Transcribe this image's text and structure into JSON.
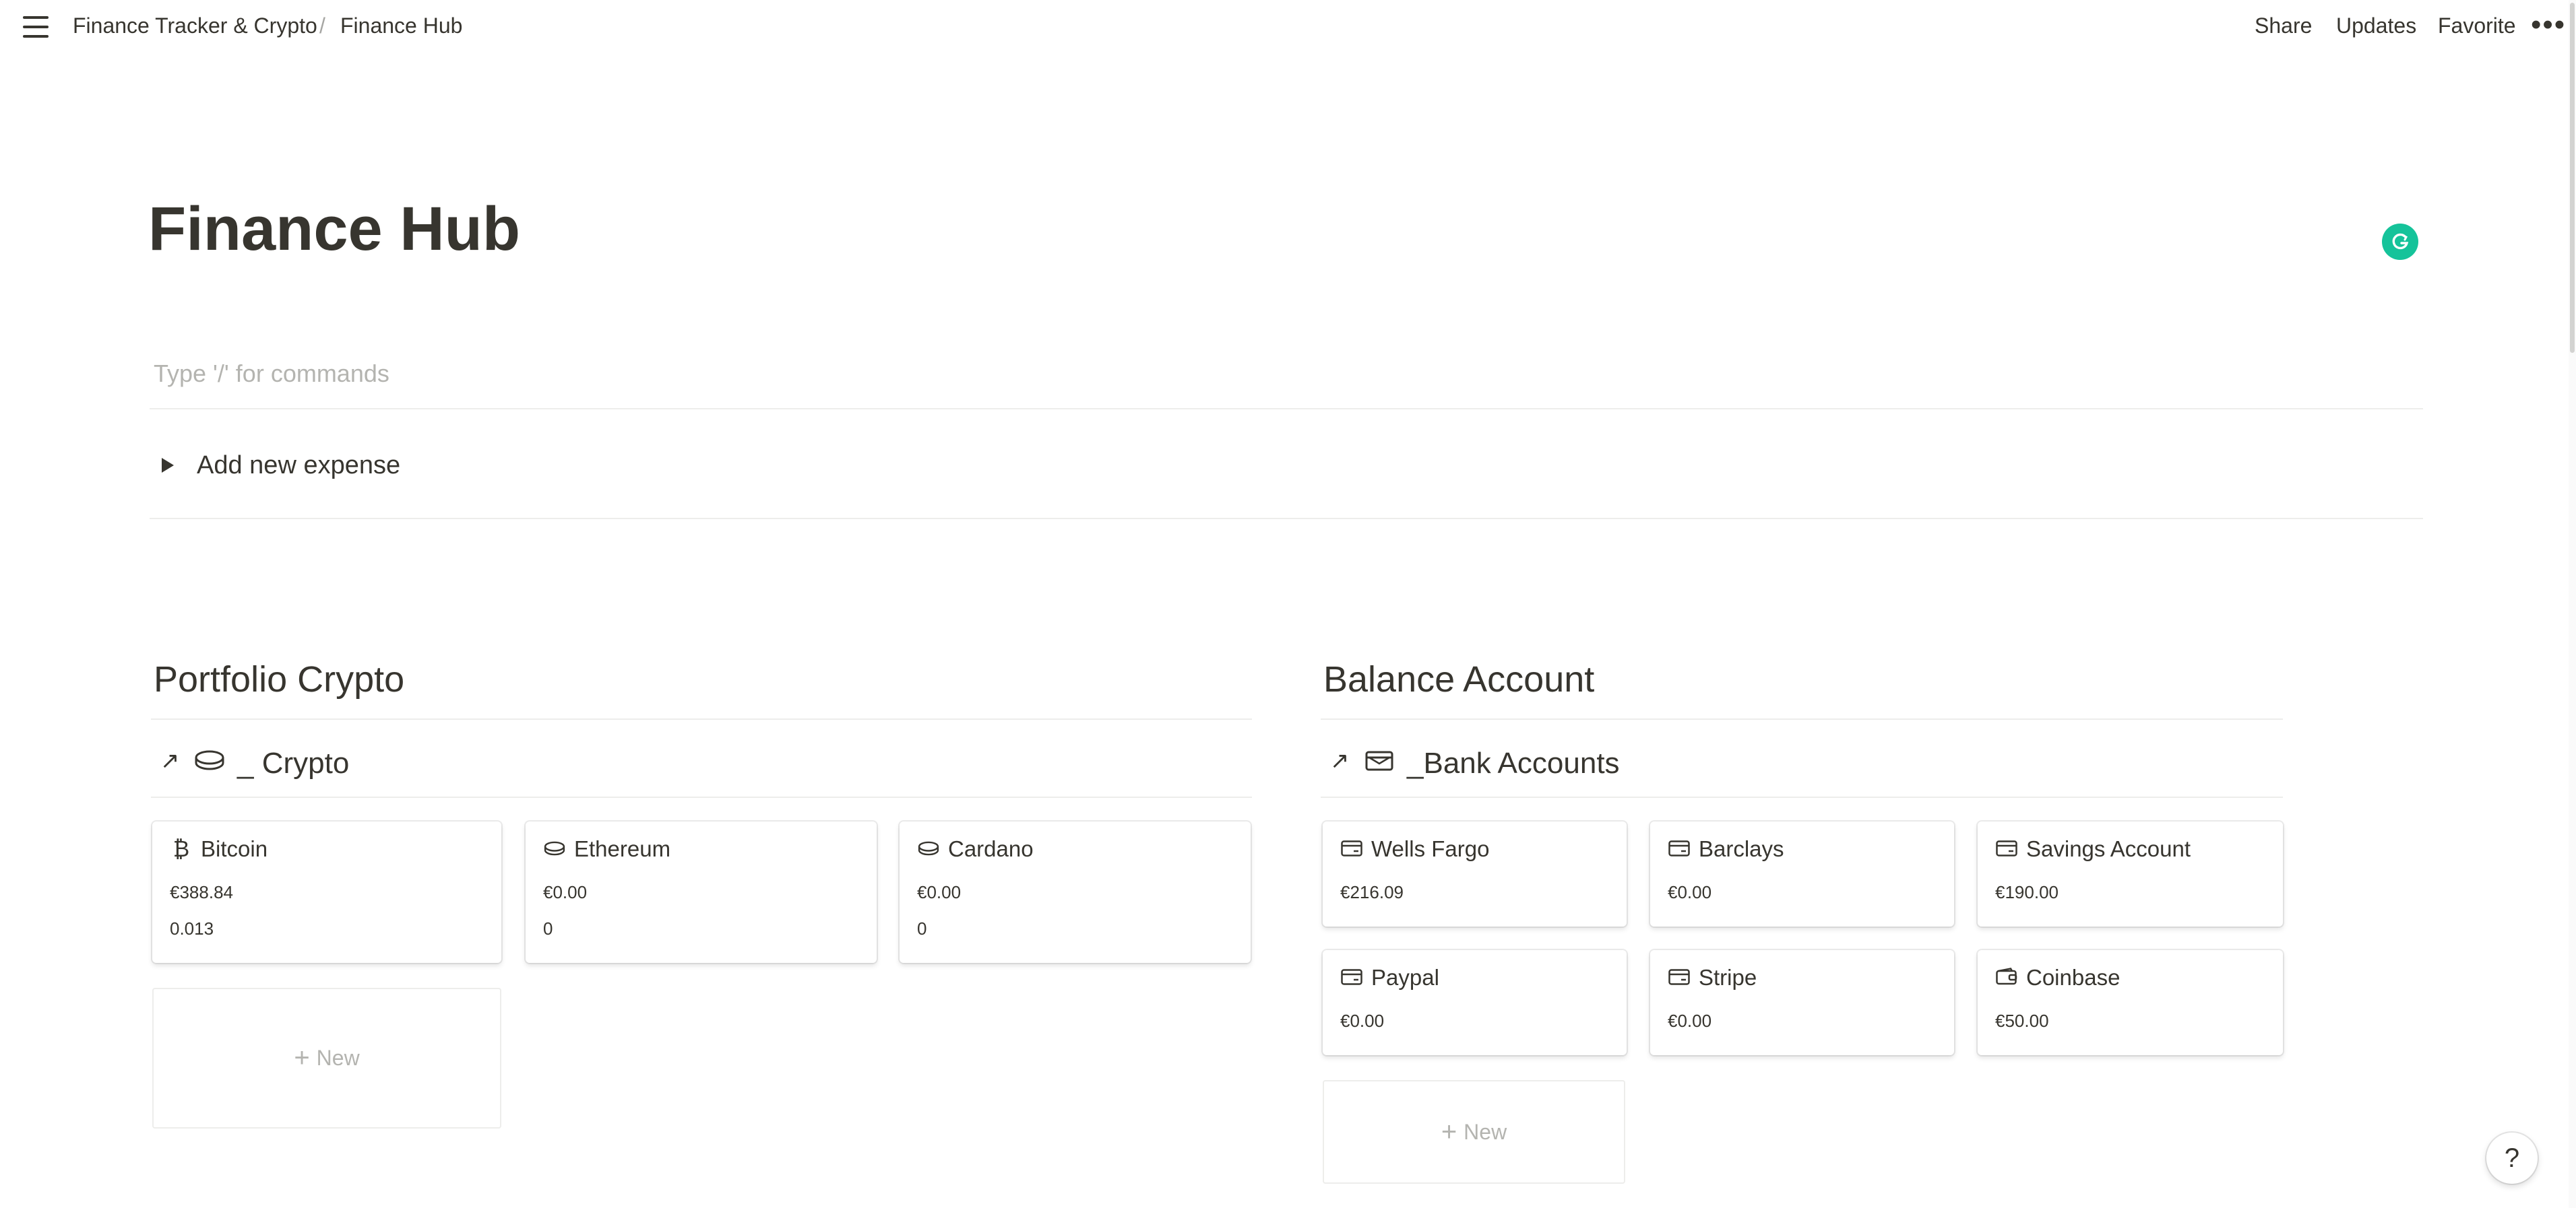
{
  "topbar": {
    "breadcrumb": [
      "Finance Tracker & Crypto",
      "Finance Hub"
    ],
    "breadcrumb_separator": "/",
    "actions": {
      "share": "Share",
      "updates": "Updates",
      "favorite": "Favorite"
    },
    "more": "•••"
  },
  "page": {
    "title": "Finance Hub",
    "placeholder": "Type '/' for commands",
    "toggle_label": "Add new expense"
  },
  "crypto": {
    "heading": "Portfolio Crypto",
    "db_title": "_ Crypto",
    "cards": [
      {
        "name": "Bitcoin",
        "icon": "bitcoin-icon",
        "value": "€388.84",
        "amount": "0.013"
      },
      {
        "name": "Ethereum",
        "icon": "coin-icon",
        "value": "€0.00",
        "amount": "0"
      },
      {
        "name": "Cardano",
        "icon": "coin-icon",
        "value": "€0.00",
        "amount": "0"
      }
    ],
    "new_label": "New"
  },
  "balance": {
    "heading": "Balance Account",
    "db_title": "_Bank Accounts",
    "cards": [
      {
        "name": "Wells Fargo",
        "icon": "credit-card-icon",
        "value": "€216.09"
      },
      {
        "name": "Barclays",
        "icon": "credit-card-icon",
        "value": "€0.00"
      },
      {
        "name": "Savings Account",
        "icon": "credit-card-icon",
        "value": "€190.00"
      },
      {
        "name": "Paypal",
        "icon": "credit-card-icon",
        "value": "€0.00"
      },
      {
        "name": "Stripe",
        "icon": "credit-card-icon",
        "value": "€0.00"
      },
      {
        "name": "Coinbase",
        "icon": "wallet-icon",
        "value": "€50.00"
      }
    ],
    "new_label": "New"
  },
  "help": "?",
  "colors": {
    "text": "#37352f",
    "muted": "#b4b4b0",
    "divider": "#ededeb",
    "grammarly": "#15c39a"
  }
}
